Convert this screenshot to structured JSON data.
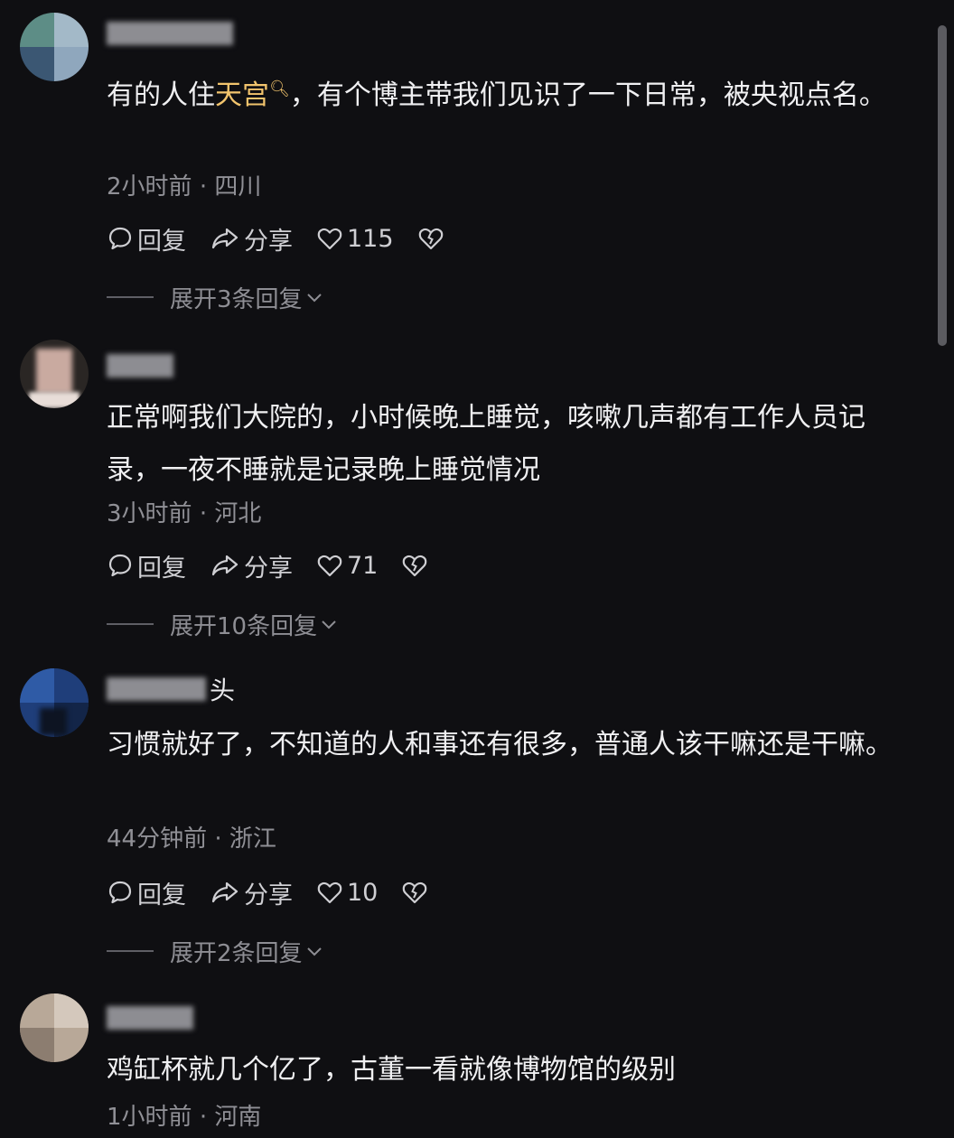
{
  "comments": [
    {
      "username_tail": "",
      "text_before": "有的人住",
      "highlight": "天宫",
      "text_after": "，有个博主带我们见识了一下日常，被央视点名。",
      "time": "2小时前",
      "location": "四川",
      "reply_label": "回复",
      "share_label": "分享",
      "likes": "115",
      "expand_label": "展开3条回复"
    },
    {
      "username_tail": "",
      "text": "正常啊我们大院的，小时候晚上睡觉，咳嗽几声都有工作人员记录，一夜不睡就是记录晚上睡觉情况",
      "time": "3小时前",
      "location": "河北",
      "reply_label": "回复",
      "share_label": "分享",
      "likes": "71",
      "expand_label": "展开10条回复"
    },
    {
      "username_tail": "头",
      "text": "习惯就好了，不知道的人和事还有很多，普通人该干嘛还是干嘛。",
      "time": "44分钟前",
      "location": "浙江",
      "reply_label": "回复",
      "share_label": "分享",
      "likes": "10",
      "expand_label": "展开2条回复"
    },
    {
      "username_tail": "",
      "text": "鸡缸杯就几个亿了，古董一看就像博物馆的级别",
      "time": "1小时前",
      "location": "河南"
    }
  ],
  "meta_separator": "·",
  "colors": {
    "highlight": "#f2c46d",
    "background": "#0f0f12"
  },
  "icons": [
    "comment-bubble-icon",
    "share-arrow-icon",
    "heart-icon",
    "broken-heart-icon",
    "search-icon",
    "chevron-down-icon"
  ]
}
